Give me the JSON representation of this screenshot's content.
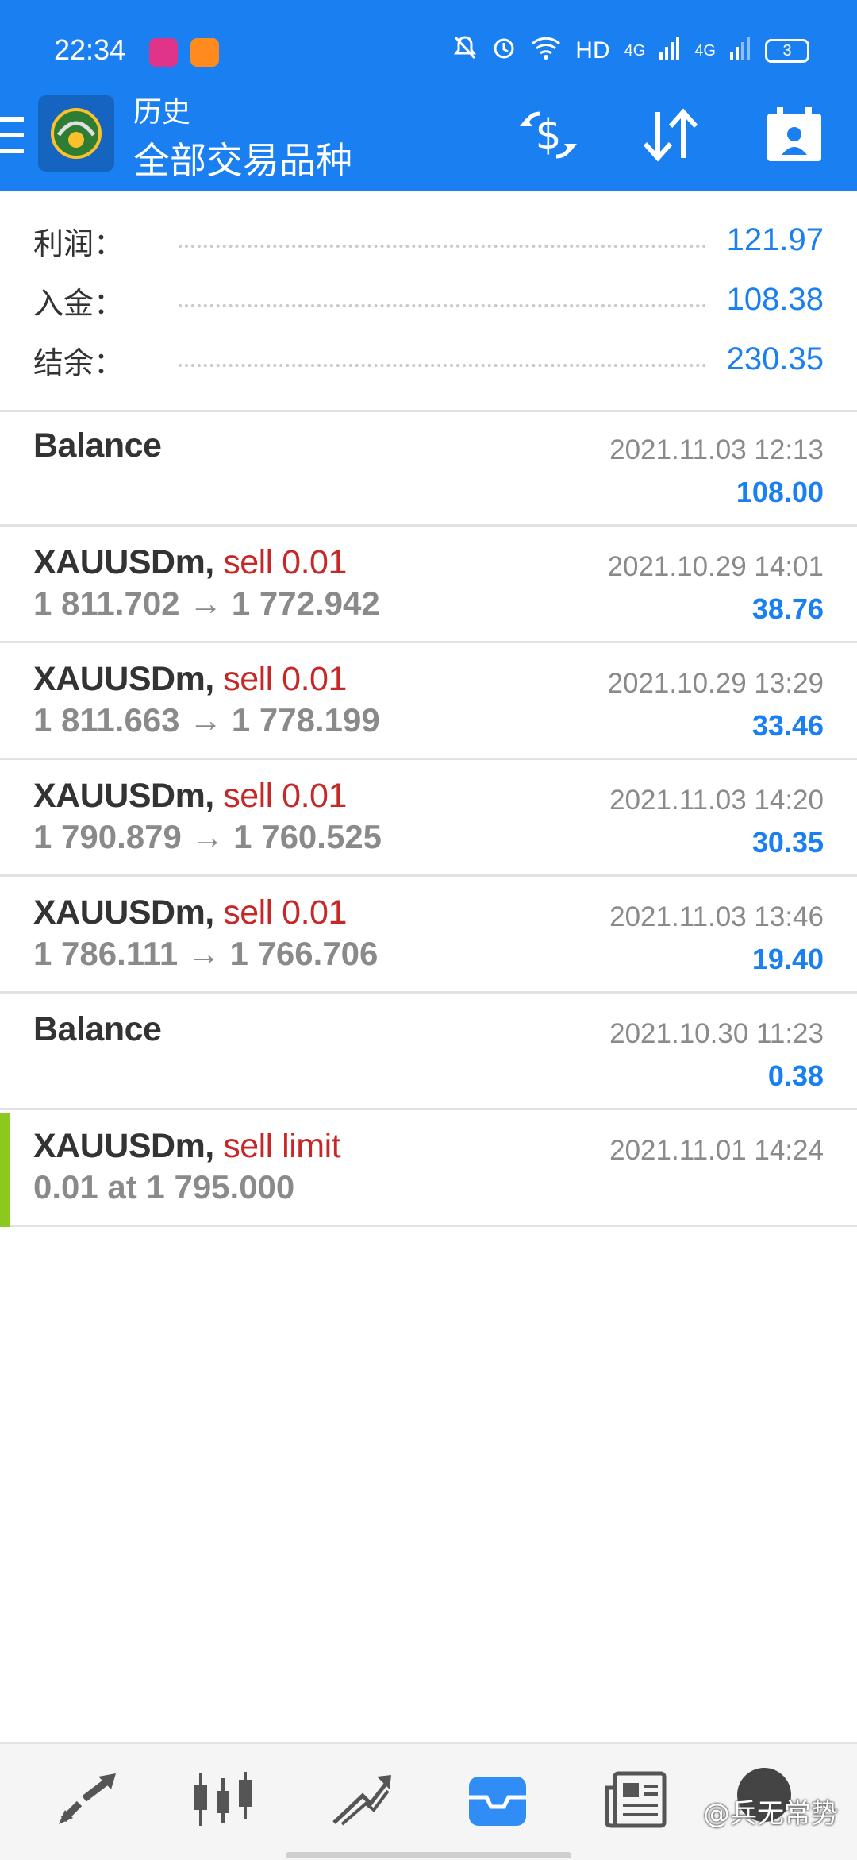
{
  "status_bar": {
    "time": "22:34",
    "network": "HD",
    "signal1": "4G",
    "signal2": "4G",
    "battery": "3"
  },
  "header": {
    "subtitle": "历史",
    "title": "全部交易品种"
  },
  "summary": [
    {
      "label": "利润：",
      "value": "121.97"
    },
    {
      "label": "入金：",
      "value": "108.38"
    },
    {
      "label": "结余：",
      "value": "230.35"
    }
  ],
  "deals": [
    {
      "symbol": "Balance",
      "type": "",
      "prices": "",
      "time": "2021.11.03 12:13",
      "profit": "108.00"
    },
    {
      "symbol": "XAUUSDm,",
      "type": "sell 0.01",
      "prices": "1 811.702 → 1 772.942",
      "time": "2021.10.29 14:01",
      "profit": "38.76"
    },
    {
      "symbol": "XAUUSDm,",
      "type": "sell 0.01",
      "prices": "1 811.663 → 1 778.199",
      "time": "2021.10.29 13:29",
      "profit": "33.46"
    },
    {
      "symbol": "XAUUSDm,",
      "type": "sell 0.01",
      "prices": "1 790.879 → 1 760.525",
      "time": "2021.11.03 14:20",
      "profit": "30.35"
    },
    {
      "symbol": "XAUUSDm,",
      "type": "sell 0.01",
      "prices": "1 786.111 → 1 766.706",
      "time": "2021.11.03 13:46",
      "profit": "19.40"
    },
    {
      "symbol": "Balance",
      "type": "",
      "prices": "",
      "time": "2021.10.30 11:23",
      "profit": "0.38"
    },
    {
      "symbol": "XAUUSDm,",
      "type": "sell limit",
      "prices": "0.01 at 1 795.000",
      "time": "2021.11.01 14:24",
      "profit": ""
    }
  ],
  "bottom_nav": [
    "quotes-icon",
    "chart-icon",
    "trade-icon",
    "history-icon",
    "news-icon"
  ],
  "watermark": "@兵无常势",
  "colors": {
    "accent": "#1a7ff0",
    "sell": "#c62828",
    "order_marker": "#8bc91e"
  }
}
